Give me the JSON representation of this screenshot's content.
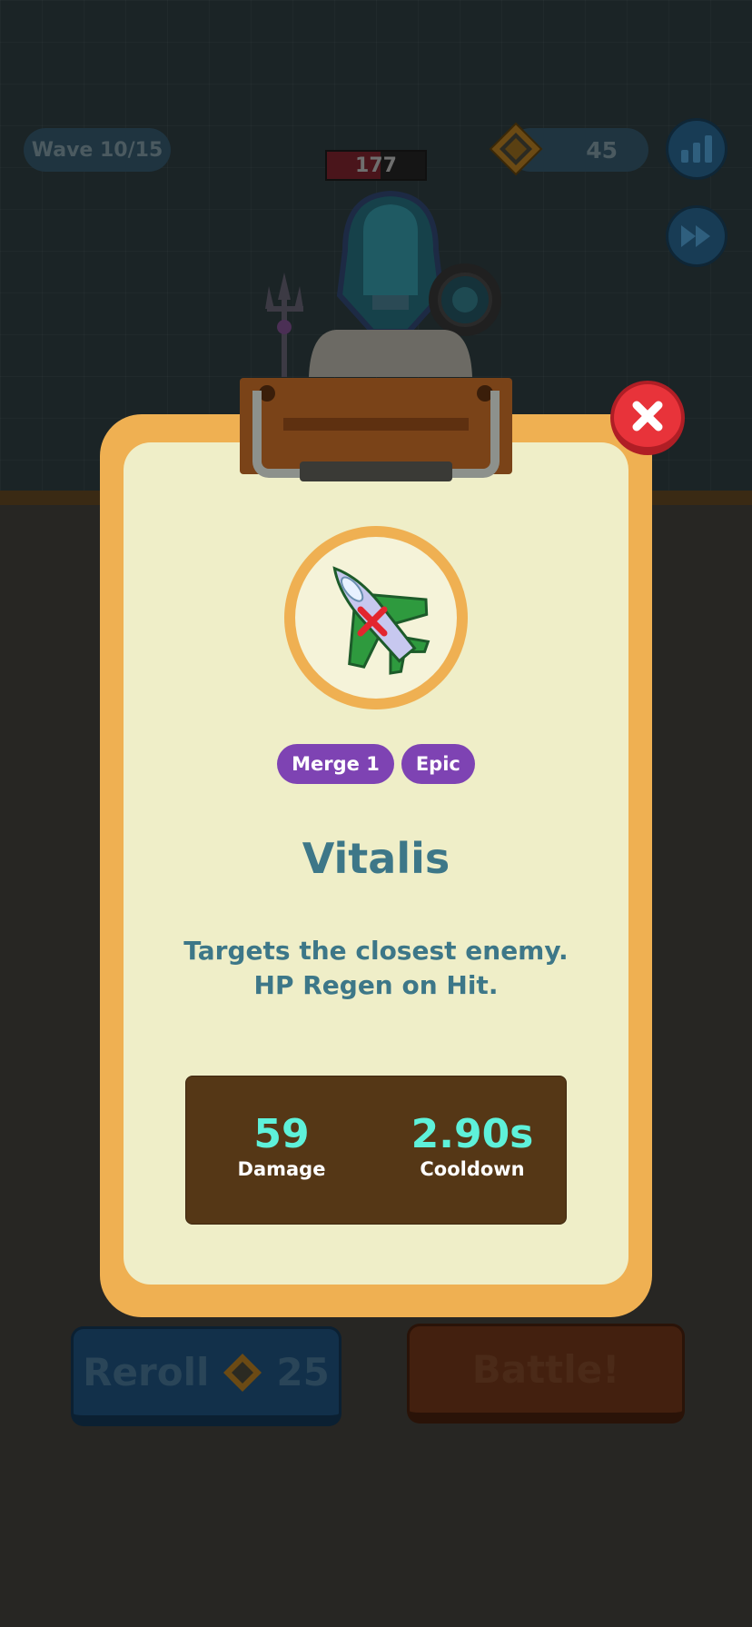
{
  "hud": {
    "wave_label": "Wave 10/15",
    "enemy_hp": "177",
    "enemy_hp_fraction": 0.55,
    "currency_amount": "45",
    "icons": {
      "currency": "diamond-gem-icon",
      "stats": "bar-chart-icon",
      "speed": "fast-forward-icon"
    }
  },
  "actions": {
    "reroll_label": "Reroll",
    "reroll_cost": "25",
    "battle_label": "Battle!"
  },
  "modal": {
    "close_icon": "close-icon",
    "item_icon": "green-jet-icon",
    "tags": [
      "Merge 1",
      "Epic"
    ],
    "name": "Vitalis",
    "description": "Targets the closest enemy. HP Regen on Hit.",
    "stats": [
      {
        "value": "59",
        "label": "Damage"
      },
      {
        "value": "2.90s",
        "label": "Cooldown"
      }
    ]
  },
  "colors": {
    "frame": "#efb052",
    "paper": "#efeec8",
    "title_text": "#3d7788",
    "tag": "#7e43b3",
    "stat_value": "#5ef1da",
    "stats_box": "#553716",
    "close": "#e8333a"
  }
}
